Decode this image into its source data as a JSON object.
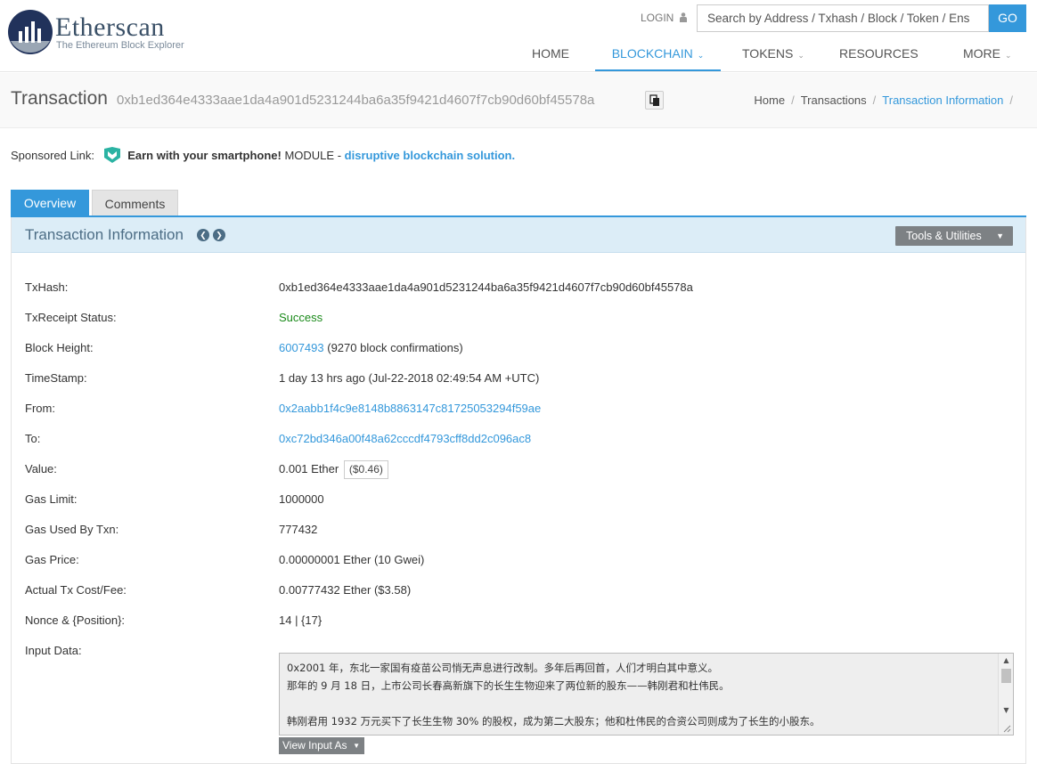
{
  "header": {
    "logo_title": "Etherscan",
    "logo_subtitle": "The Ethereum Block Explorer",
    "login_label": "LOGIN",
    "search_placeholder": "Search by Address / Txhash / Block / Token / Ens",
    "go_label": "GO",
    "nav": [
      {
        "label": "HOME",
        "dropdown": false
      },
      {
        "label": "BLOCKCHAIN",
        "dropdown": true,
        "active": true
      },
      {
        "label": "TOKENS",
        "dropdown": true
      },
      {
        "label": "RESOURCES",
        "dropdown": false
      },
      {
        "label": "MORE",
        "dropdown": true
      }
    ],
    "accent_color": "#3498db"
  },
  "titlebar": {
    "title": "Transaction",
    "hash": "0xb1ed364e4333aae1da4a901d5231244ba6a35f9421d4607f7cb90d60bf45578a",
    "breadcrumb": [
      "Home",
      "Transactions",
      "Transaction Information"
    ]
  },
  "sponsored": {
    "label": "Sponsored Link:",
    "bold": "Earn with your smartphone!",
    "text": "MODULE -",
    "link": "disruptive blockchain solution."
  },
  "tabs": [
    "Overview",
    "Comments"
  ],
  "panel": {
    "title": "Transaction Information",
    "tools_label": "Tools & Utilities",
    "rows": [
      {
        "label": "TxHash:",
        "value": "0xb1ed364e4333aae1da4a901d5231244ba6a35f9421d4607f7cb90d60bf45578a"
      },
      {
        "label": "TxReceipt Status:",
        "value": "Success"
      },
      {
        "label": "Block Height:",
        "value": "6007493",
        "extra": "(9270 block confirmations)"
      },
      {
        "label": "TimeStamp:",
        "value": "1 day 13 hrs ago (Jul-22-2018 02:49:54 AM +UTC)"
      },
      {
        "label": "From:",
        "value": "0x2aabb1f4c9e8148b8863147c81725053294f59ae"
      },
      {
        "label": "To:",
        "value": "0xc72bd346a00f48a62cccdf4793cff8dd2c096ac8"
      },
      {
        "label": "Value:",
        "value": "0.001 Ether",
        "extra": "($0.46)"
      },
      {
        "label": "Gas Limit:",
        "value": "1000000"
      },
      {
        "label": "Gas Used By Txn:",
        "value": "777432"
      },
      {
        "label": "Gas Price:",
        "value": "0.00000001 Ether (10 Gwei)"
      },
      {
        "label": "Actual Tx Cost/Fee:",
        "value": "0.00777432 Ether ($3.58)"
      },
      {
        "label": "Nonce & {Position}:",
        "value": "14 | {17}"
      },
      {
        "label": "Input Data:"
      }
    ],
    "input_data_lines": [
      "0x2001 年，东北一家国有疫苗公司悄无声息进行改制。多年后再回首，人们才明白其中意义。",
      "那年的 9 月 18 日，上市公司长春高新旗下的长生生物迎来了两位新的股东——韩刚君和杜伟民。",
      "",
      "韩刚君用 1932 万元买下了长生生物 30% 的股权，成为第二大股东；他和杜伟民的合资公司则成为了长生的小股东。"
    ],
    "view_input_label": "View Input As"
  }
}
